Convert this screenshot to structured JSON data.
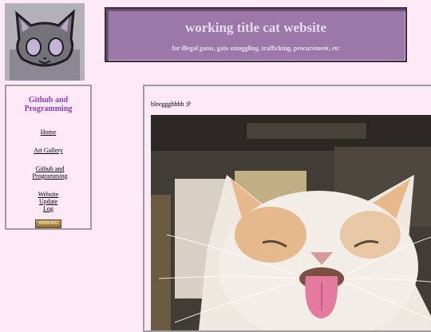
{
  "header": {
    "title": "working title cat website",
    "subtitle": "for illegal gatos, gato smuggling, trafficking, procurement, etc"
  },
  "sidebar": {
    "heading": "Github and Programming",
    "nav": {
      "home": "Home",
      "art": "Art Gallery",
      "github": "Github and Programming",
      "log": "Website Update Log"
    },
    "badge": "WEBRING"
  },
  "main": {
    "caption": "bleeggghhhh :P"
  }
}
